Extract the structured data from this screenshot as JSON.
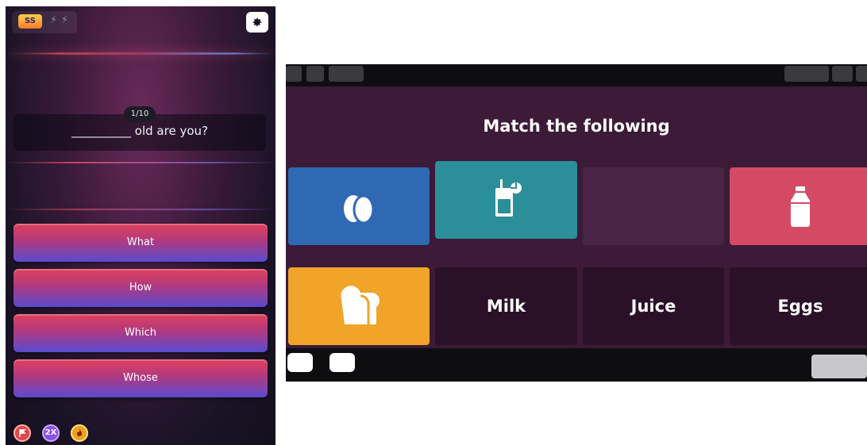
{
  "quiz": {
    "logo_text": "SS",
    "bolt_icon": "⚡",
    "settings_icon": "gear-icon",
    "progress": "1/10",
    "question": "__________ old are you?",
    "options": [
      "What",
      "How",
      "Which",
      "Whose"
    ],
    "powerups": [
      {
        "name": "powerup-red",
        "label": "",
        "color": "#e0474c"
      },
      {
        "name": "powerup-2x",
        "label": "2X",
        "color": "#8b50e6"
      },
      {
        "name": "powerup-gold",
        "label": "",
        "color": "#f0a020"
      }
    ]
  },
  "match_game": {
    "title": "Match the following",
    "image_tiles": [
      {
        "name": "eggs-image-tile",
        "icon": "eggs-icon",
        "color": "#2f69b3"
      },
      {
        "name": "juice-image-tile",
        "icon": "juice-icon",
        "color": "#2a8f98"
      },
      {
        "name": "empty-tile",
        "icon": "",
        "color": "#4a2444"
      },
      {
        "name": "milk-image-tile",
        "icon": "milk-bottle-icon",
        "color": "#d44a64"
      },
      {
        "name": "bread-image-tile",
        "icon": "bread-icon",
        "color": "#f0a42a"
      }
    ],
    "word_tiles": [
      "Milk",
      "Juice",
      "Eggs"
    ]
  }
}
